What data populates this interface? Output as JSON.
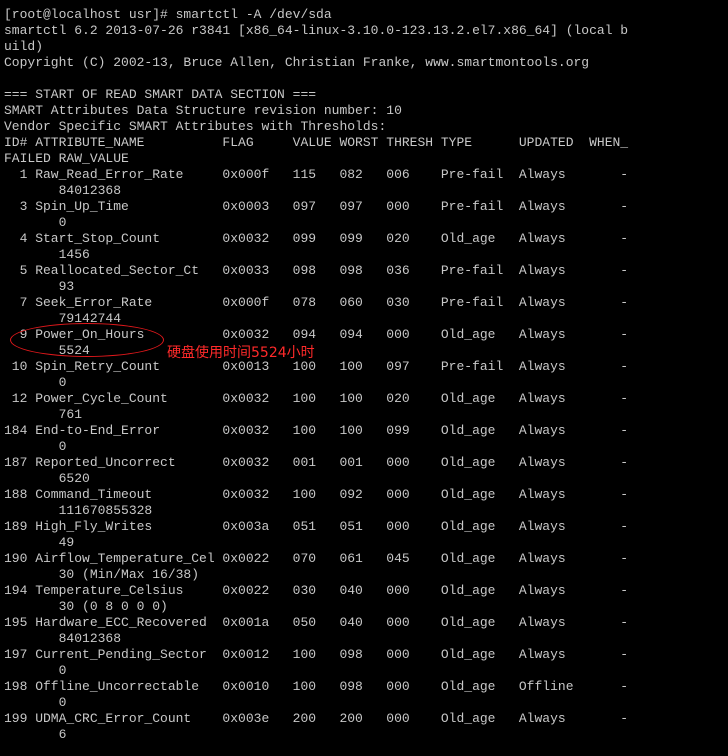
{
  "terminal": {
    "lines": [
      "[root@localhost usr]# smartctl -A /dev/sda",
      "smartctl 6.2 2013-07-26 r3841 [x86_64-linux-3.10.0-123.13.2.el7.x86_64] (local b",
      "uild)",
      "Copyright (C) 2002-13, Bruce Allen, Christian Franke, www.smartmontools.org",
      "",
      "=== START OF READ SMART DATA SECTION ===",
      "SMART Attributes Data Structure revision number: 10",
      "Vendor Specific SMART Attributes with Thresholds:",
      "ID# ATTRIBUTE_NAME          FLAG     VALUE WORST THRESH TYPE      UPDATED  WHEN_",
      "FAILED RAW_VALUE",
      "  1 Raw_Read_Error_Rate     0x000f   115   082   006    Pre-fail  Always       -",
      "       84012368",
      "  3 Spin_Up_Time            0x0003   097   097   000    Pre-fail  Always       -",
      "       0",
      "  4 Start_Stop_Count        0x0032   099   099   020    Old_age   Always       -",
      "       1456",
      "  5 Reallocated_Sector_Ct   0x0033   098   098   036    Pre-fail  Always       -",
      "       93",
      "  7 Seek_Error_Rate         0x000f   078   060   030    Pre-fail  Always       -",
      "       79142744",
      "  9 Power_On_Hours          0x0032   094   094   000    Old_age   Always       -",
      "       5524",
      " 10 Spin_Retry_Count        0x0013   100   100   097    Pre-fail  Always       -",
      "       0",
      " 12 Power_Cycle_Count       0x0032   100   100   020    Old_age   Always       -",
      "       761",
      "184 End-to-End_Error        0x0032   100   100   099    Old_age   Always       -",
      "       0",
      "187 Reported_Uncorrect      0x0032   001   001   000    Old_age   Always       -",
      "       6520",
      "188 Command_Timeout         0x0032   100   092   000    Old_age   Always       -",
      "       111670855328",
      "189 High_Fly_Writes         0x003a   051   051   000    Old_age   Always       -",
      "       49",
      "190 Airflow_Temperature_Cel 0x0022   070   061   045    Old_age   Always       -",
      "       30 (Min/Max 16/38)",
      "194 Temperature_Celsius     0x0022   030   040   000    Old_age   Always       -",
      "       30 (0 8 0 0 0)",
      "195 Hardware_ECC_Recovered  0x001a   050   040   000    Old_age   Always       -",
      "       84012368",
      "197 Current_Pending_Sector  0x0012   100   098   000    Old_age   Always       -",
      "       0",
      "198 Offline_Uncorrectable   0x0010   100   098   000    Old_age   Offline      -",
      "       0",
      "199 UDMA_CRC_Error_Count    0x003e   200   200   000    Old_age   Always       -",
      "       6"
    ]
  },
  "annotation": {
    "text": "硬盘使用时间5524小时",
    "color": "#e0181b"
  }
}
